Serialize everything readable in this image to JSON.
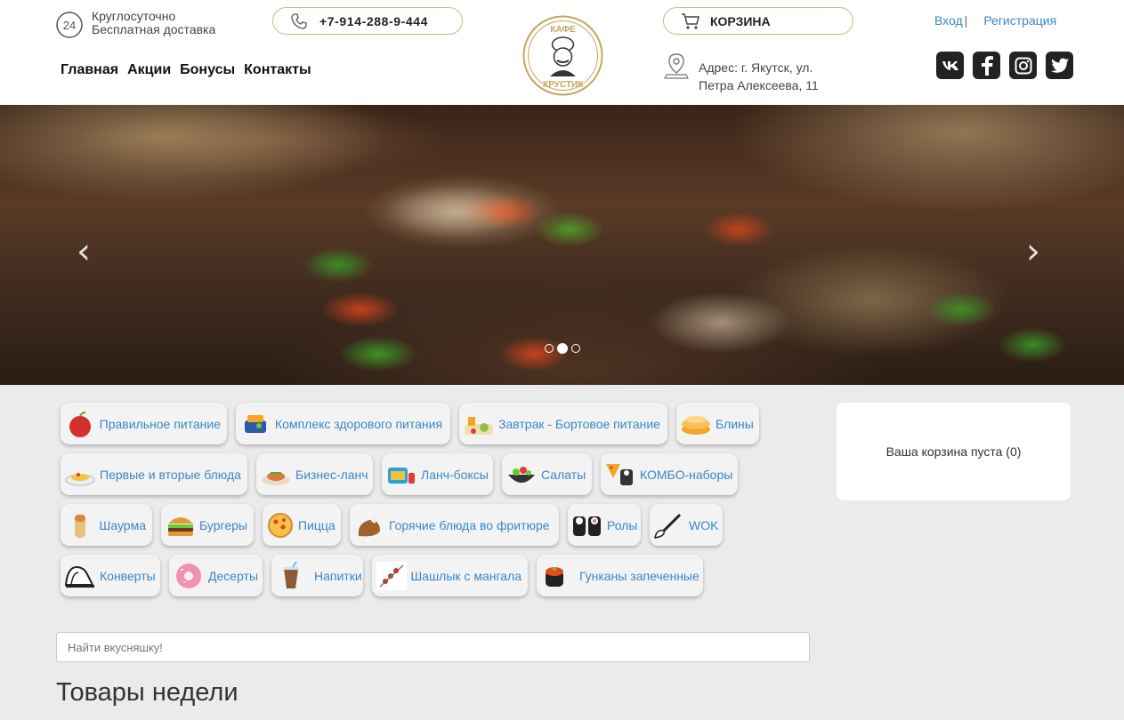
{
  "header": {
    "delivery_line1": "Круглосуточно",
    "delivery_line2": "Бесплатная доставка",
    "phone": "+7-914-288-9-444",
    "cart_label": "КОРЗИНА",
    "address_line1": "Адрес: г. Якутск, ул.",
    "address_line2": "Петра Алексеева, 11",
    "login": "Вход",
    "auth_separator": "|",
    "register": "Регистрация",
    "badge_24": "24",
    "logo_top": "КАФЕ",
    "logo_bottom": "ХРУСТИК",
    "nav": [
      "Главная",
      "Акции",
      "Бонусы",
      "Контакты"
    ],
    "socials": [
      "vk-icon",
      "facebook-icon",
      "instagram-icon",
      "twitter-icon"
    ]
  },
  "hero": {
    "prev": "‹",
    "next": "›",
    "slide_count": 3,
    "active_slide": 2
  },
  "categories": [
    [
      "Правильное питание",
      "Комплекс здорового питания",
      "Завтрак - Бортовое питание",
      "Блины"
    ],
    [
      "Первые и вторые блюда",
      "Бизнес-ланч",
      "Ланч-боксы",
      "Салаты",
      "КОМБО-наборы"
    ],
    [
      "Шаурма",
      "Бургеры",
      "Пицца",
      "Горячие блюда во фритюре",
      "Ролы",
      "WOK"
    ],
    [
      "Конверты",
      "Десерты",
      "Напитки",
      "Шашлык с мангала",
      "Гунканы запеченные"
    ]
  ],
  "cart_box": {
    "text": "Ваша корзина пуста (0)"
  },
  "search": {
    "placeholder": "Найти вкусняшку!"
  },
  "section_title": "Товары недели",
  "colors": {
    "accent_link": "#3a87c8",
    "pill_border": "#c8bd8a",
    "page_bg": "#ebebeb"
  }
}
